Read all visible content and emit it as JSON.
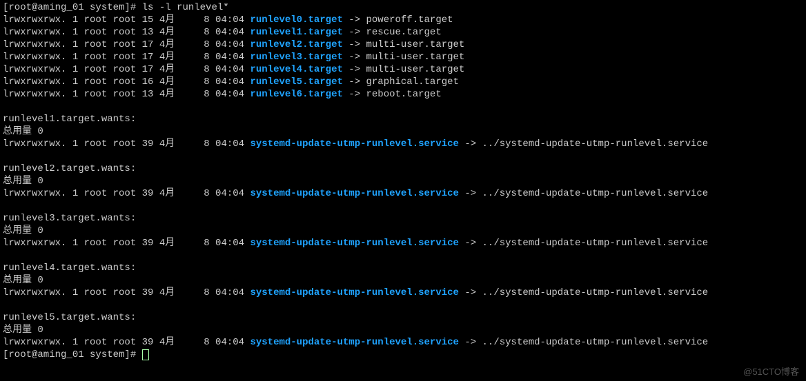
{
  "prompt1": "[root@aming_01 system]# ",
  "command": "ls -l runlevel*",
  "symlinks": [
    {
      "perms": "lrwxrwxrwx.",
      "links": "1",
      "own": "root",
      "grp": "root",
      "size": "15",
      "month": "4月",
      "day": "8",
      "time": "04:04",
      "name": "runlevel0.target",
      "tgt": "poweroff.target"
    },
    {
      "perms": "lrwxrwxrwx.",
      "links": "1",
      "own": "root",
      "grp": "root",
      "size": "13",
      "month": "4月",
      "day": "8",
      "time": "04:04",
      "name": "runlevel1.target",
      "tgt": "rescue.target"
    },
    {
      "perms": "lrwxrwxrwx.",
      "links": "1",
      "own": "root",
      "grp": "root",
      "size": "17",
      "month": "4月",
      "day": "8",
      "time": "04:04",
      "name": "runlevel2.target",
      "tgt": "multi-user.target"
    },
    {
      "perms": "lrwxrwxrwx.",
      "links": "1",
      "own": "root",
      "grp": "root",
      "size": "17",
      "month": "4月",
      "day": "8",
      "time": "04:04",
      "name": "runlevel3.target",
      "tgt": "multi-user.target"
    },
    {
      "perms": "lrwxrwxrwx.",
      "links": "1",
      "own": "root",
      "grp": "root",
      "size": "17",
      "month": "4月",
      "day": "8",
      "time": "04:04",
      "name": "runlevel4.target",
      "tgt": "multi-user.target"
    },
    {
      "perms": "lrwxrwxrwx.",
      "links": "1",
      "own": "root",
      "grp": "root",
      "size": "16",
      "month": "4月",
      "day": "8",
      "time": "04:04",
      "name": "runlevel5.target",
      "tgt": "graphical.target"
    },
    {
      "perms": "lrwxrwxrwx.",
      "links": "1",
      "own": "root",
      "grp": "root",
      "size": "13",
      "month": "4月",
      "day": "8",
      "time": "04:04",
      "name": "runlevel6.target",
      "tgt": "reboot.target"
    }
  ],
  "wants_dirs": [
    {
      "header": "runlevel1.target.wants:",
      "total": "总用量 0",
      "rows": [
        {
          "perms": "lrwxrwxrwx.",
          "links": "1",
          "own": "root",
          "grp": "root",
          "size": "39",
          "month": "4月",
          "day": "8",
          "time": "04:04",
          "name": "systemd-update-utmp-runlevel.service",
          "tgt": "../systemd-update-utmp-runlevel.service"
        }
      ]
    },
    {
      "header": "runlevel2.target.wants:",
      "total": "总用量 0",
      "rows": [
        {
          "perms": "lrwxrwxrwx.",
          "links": "1",
          "own": "root",
          "grp": "root",
          "size": "39",
          "month": "4月",
          "day": "8",
          "time": "04:04",
          "name": "systemd-update-utmp-runlevel.service",
          "tgt": "../systemd-update-utmp-runlevel.service"
        }
      ]
    },
    {
      "header": "runlevel3.target.wants:",
      "total": "总用量 0",
      "rows": [
        {
          "perms": "lrwxrwxrwx.",
          "links": "1",
          "own": "root",
          "grp": "root",
          "size": "39",
          "month": "4月",
          "day": "8",
          "time": "04:04",
          "name": "systemd-update-utmp-runlevel.service",
          "tgt": "../systemd-update-utmp-runlevel.service"
        }
      ]
    },
    {
      "header": "runlevel4.target.wants:",
      "total": "总用量 0",
      "rows": [
        {
          "perms": "lrwxrwxrwx.",
          "links": "1",
          "own": "root",
          "grp": "root",
          "size": "39",
          "month": "4月",
          "day": "8",
          "time": "04:04",
          "name": "systemd-update-utmp-runlevel.service",
          "tgt": "../systemd-update-utmp-runlevel.service"
        }
      ]
    },
    {
      "header": "runlevel5.target.wants:",
      "total": "总用量 0",
      "rows": [
        {
          "perms": "lrwxrwxrwx.",
          "links": "1",
          "own": "root",
          "grp": "root",
          "size": "39",
          "month": "4月",
          "day": "8",
          "time": "04:04",
          "name": "systemd-update-utmp-runlevel.service",
          "tgt": "../systemd-update-utmp-runlevel.service"
        }
      ]
    }
  ],
  "prompt2": "[root@aming_01 system]# ",
  "watermark": "@51CTO博客"
}
